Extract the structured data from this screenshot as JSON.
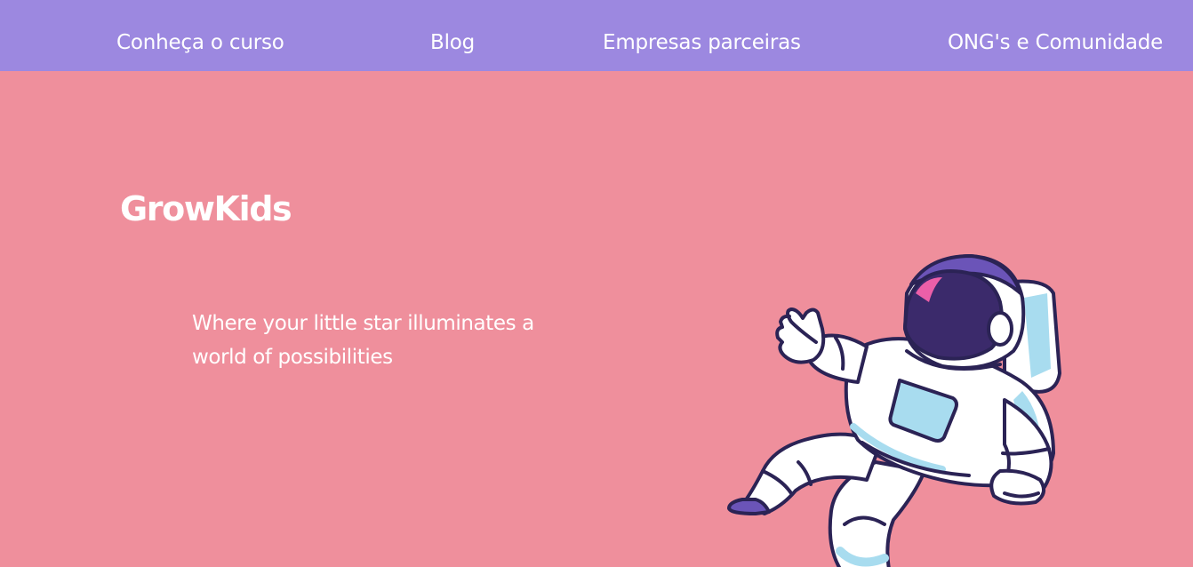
{
  "nav": {
    "items": [
      {
        "label": "Conheça o curso"
      },
      {
        "label": "Blog"
      },
      {
        "label": "Empresas parceiras"
      },
      {
        "label": "ONG's e Comunidade"
      }
    ]
  },
  "hero": {
    "brand": "GrowKids",
    "tagline": "Where your little star illuminates a world of possibilities",
    "illustration": "astronaut-illustration"
  },
  "colors": {
    "nav_bg": "#9c88e0",
    "page_bg": "#ef8f9c",
    "text": "#ffffff"
  }
}
